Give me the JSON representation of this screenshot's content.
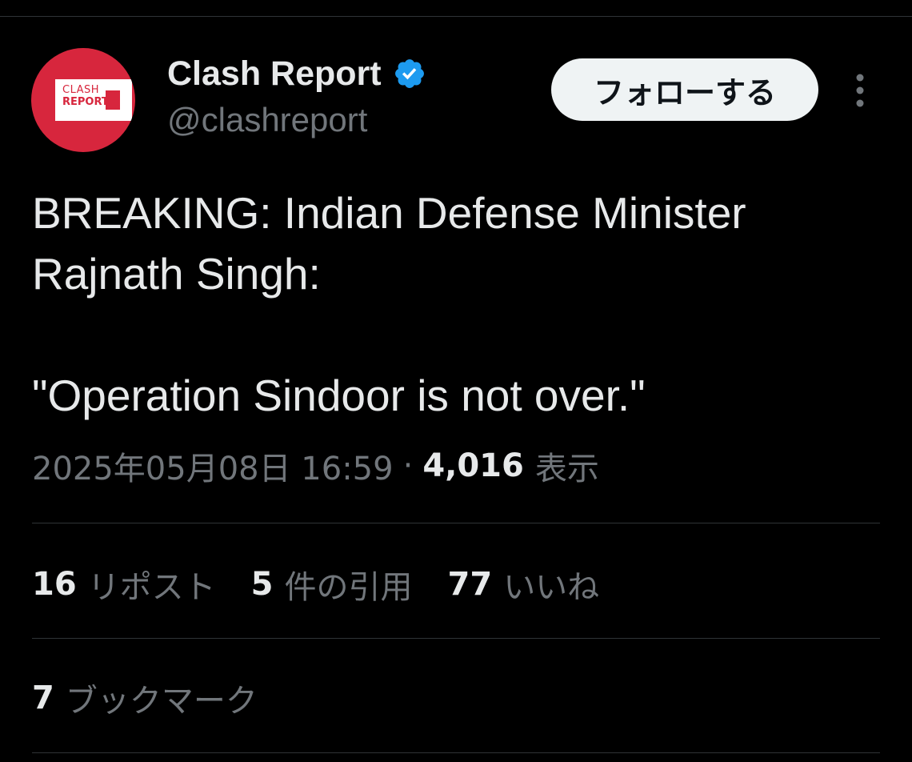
{
  "author": {
    "display_name": "Clash Report",
    "handle": "@clashreport",
    "avatar_line1": "CLASH",
    "avatar_line2": "REPORT",
    "verified_icon": "verified-badge-icon",
    "verified_color": "#1d9bf0"
  },
  "actions": {
    "follow_label": "フォローする",
    "more_icon": "more-vertical-icon"
  },
  "tweet": {
    "text": "BREAKING: Indian Defense Minister\nRajnath Singh:\n\n\"Operation Sindoor is not over.\""
  },
  "meta": {
    "timestamp": "2025年05月08日 16:59",
    "separator": "·",
    "views_count": "4,016",
    "views_label": "表示"
  },
  "stats": {
    "reposts_count": "16",
    "reposts_label": "リポスト",
    "quotes_count": "5",
    "quotes_label": "件の引用",
    "likes_count": "77",
    "likes_label": "いいね",
    "bookmarks_count": "7",
    "bookmarks_label": "ブックマーク"
  },
  "colors": {
    "background": "#000000",
    "text_primary": "#e7e9ea",
    "text_secondary": "#71767b",
    "divider": "#2f3336",
    "avatar_red": "#d7263d",
    "button_bg": "#eff3f4"
  }
}
